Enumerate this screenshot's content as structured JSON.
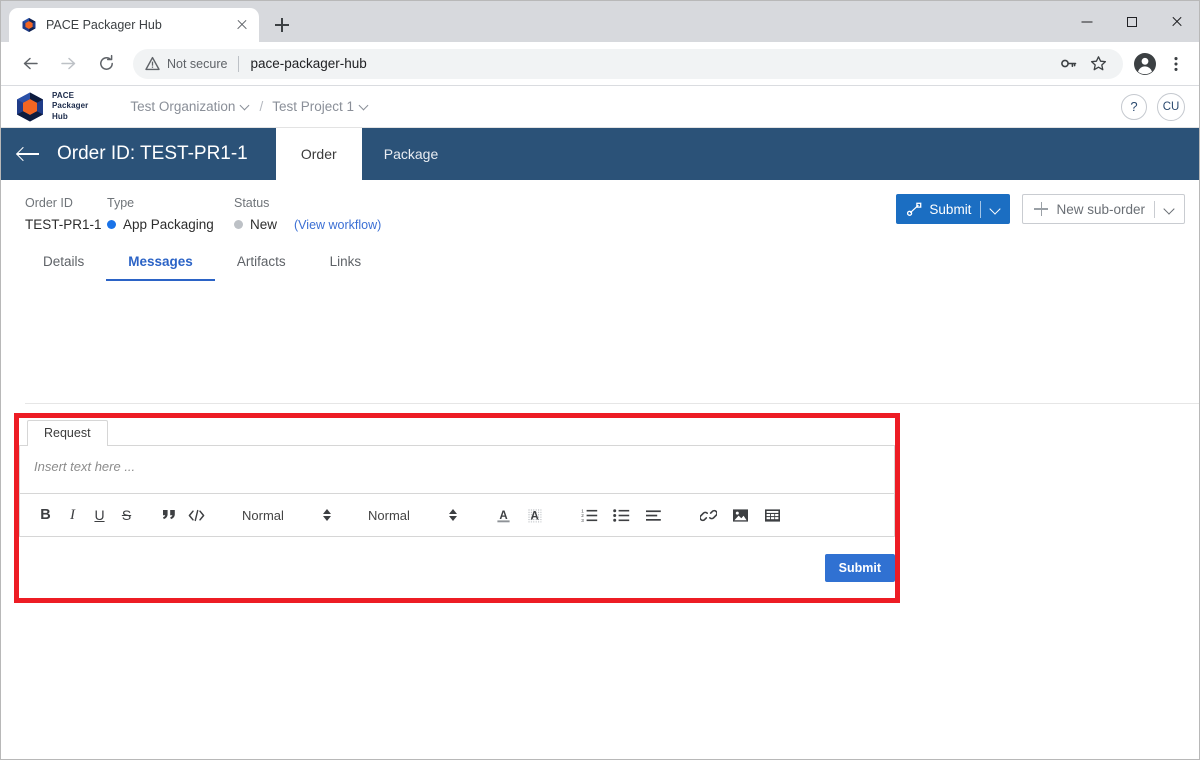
{
  "browser": {
    "tab": {
      "title": "PACE Packager Hub",
      "favicon": "cube-icon",
      "close": "close-icon"
    },
    "newtab_label": "new-tab-icon",
    "window": {
      "minimize": "minimize-icon",
      "maximize": "maximize-icon",
      "close": "close-icon"
    },
    "nav": {
      "back": "←",
      "forward": "→",
      "reload": "↻"
    },
    "omnibox": {
      "security_label": "Not secure",
      "security_icon": "warning-triangle-icon",
      "url": "pace-packager-hub"
    },
    "omnibox_icons": [
      "key-icon",
      "star-icon"
    ],
    "profile_icon": "profile-avatar-icon",
    "menu_icon": "three-dot-menu-icon"
  },
  "app_header": {
    "logo": {
      "icon": "pace-cube-logo",
      "line1": "PACE",
      "line2": "Packager",
      "line3": "Hub"
    },
    "breadcrumb": {
      "organization": "Test Organization",
      "separator": "/",
      "project": "Test Project 1"
    },
    "help_label": "?",
    "avatar_initials": "CU"
  },
  "order_bar": {
    "back_icon": "back-arrow-icon",
    "title": "Order ID: TEST-PR1-1",
    "tabs": [
      {
        "label": "Order",
        "active": true
      },
      {
        "label": "Package",
        "active": false
      }
    ]
  },
  "meta": {
    "fields": [
      {
        "label": "Order ID",
        "value": "TEST-PR1-1",
        "dot": null
      },
      {
        "label": "Type",
        "value": "App Packaging",
        "dot": "#1a73e8"
      },
      {
        "label": "Status",
        "value": "New",
        "dot": "#bdc1c6"
      }
    ],
    "workflow_link": "(View workflow)"
  },
  "actions": {
    "submit": {
      "label": "Submit",
      "icon": "workflow-branch-icon",
      "caret": "chevron-down-icon"
    },
    "new_suborder": {
      "label": "New sub-order",
      "icon": "plus-icon",
      "caret": "chevron-down-icon"
    }
  },
  "subtabs": [
    {
      "label": "Details",
      "active": false
    },
    {
      "label": "Messages",
      "active": true
    },
    {
      "label": "Artifacts",
      "active": false
    },
    {
      "label": "Links",
      "active": false
    }
  ],
  "editor": {
    "tabs": [
      {
        "label": "Request",
        "active": true
      }
    ],
    "placeholder": "Insert text here ...",
    "value": "",
    "toolbar": {
      "groups": [
        {
          "items": [
            {
              "name": "bold-icon",
              "glyph": "B"
            },
            {
              "name": "italic-icon",
              "glyph": "I"
            },
            {
              "name": "underline-icon",
              "glyph": "U"
            },
            {
              "name": "strikethrough-icon",
              "glyph": "S"
            }
          ]
        },
        {
          "items": [
            {
              "name": "blockquote-icon",
              "glyph": "”"
            },
            {
              "name": "code-block-icon",
              "glyph": "</>"
            }
          ]
        }
      ],
      "selects": [
        {
          "name": "font-select",
          "value": "Normal"
        },
        {
          "name": "size-select",
          "value": "Normal"
        }
      ],
      "color_items": [
        {
          "name": "text-color-icon",
          "glyph": "A"
        },
        {
          "name": "background-color-icon",
          "glyph": "A"
        }
      ],
      "list_items": [
        {
          "name": "ordered-list-icon"
        },
        {
          "name": "bullet-list-icon"
        },
        {
          "name": "align-icon"
        }
      ],
      "insert_items": [
        {
          "name": "link-icon"
        },
        {
          "name": "image-icon"
        },
        {
          "name": "table-icon"
        }
      ]
    },
    "submit_label": "Submit"
  },
  "colors": {
    "brand_dark": "#2b5278",
    "primary": "#1b6ec2",
    "submit_blue": "#3071d2",
    "accent_link": "#3b6fd4",
    "tab_active": "#2b63c6",
    "highlight_red": "#ed1c24",
    "type_dot": "#1a73e8",
    "status_dot": "#bdc1c6"
  }
}
